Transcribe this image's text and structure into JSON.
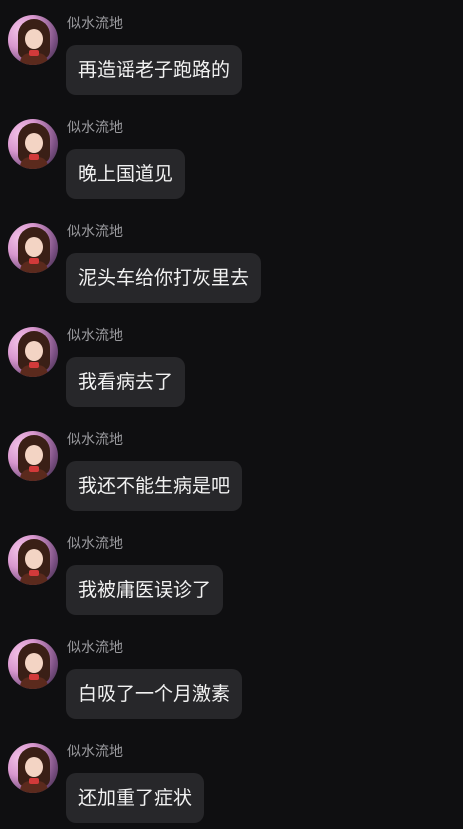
{
  "messages": [
    {
      "sender": "似水流地",
      "text": "再造谣老子跑路的"
    },
    {
      "sender": "似水流地",
      "text": "晚上国道见"
    },
    {
      "sender": "似水流地",
      "text": "泥头车给你打灰里去"
    },
    {
      "sender": "似水流地",
      "text": "我看病去了"
    },
    {
      "sender": "似水流地",
      "text": "我还不能生病是吧"
    },
    {
      "sender": "似水流地",
      "text": "我被庸医误诊了"
    },
    {
      "sender": "似水流地",
      "text": "白吸了一个月激素"
    },
    {
      "sender": "似水流地",
      "text": "还加重了症状"
    }
  ]
}
